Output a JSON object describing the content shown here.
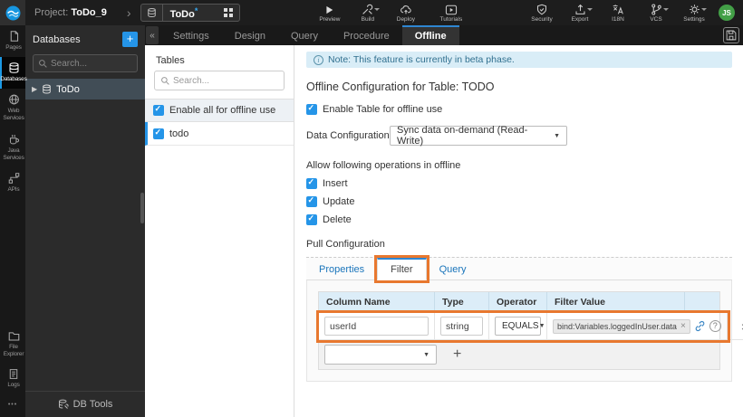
{
  "colors": {
    "accent_blue": "#2595e8",
    "annotation_orange": "#e8782f",
    "avatar_green": "#43a047",
    "note_bg": "#d9edf7"
  },
  "annotations": {
    "highlighted_tab": "Filter",
    "highlighted_row": "userId filter row",
    "color": "#e8782f"
  },
  "topbar": {
    "project_label": "Project:",
    "project_name": "ToDo_9",
    "artifact": {
      "name": "ToDo",
      "modified_mark": "*"
    },
    "actions_left": [
      {
        "label": "Preview"
      },
      {
        "label": "Build"
      },
      {
        "label": "Deploy"
      }
    ],
    "tutorials_label": "Tutorials",
    "actions_right": [
      {
        "label": "Security"
      },
      {
        "label": "Export"
      },
      {
        "label": "I18N"
      },
      {
        "label": "VCS"
      },
      {
        "label": "Settings"
      }
    ],
    "avatar_initials": "JS"
  },
  "sidebar": {
    "items_top": [
      {
        "label": "Pages"
      },
      {
        "label": "Databases"
      },
      {
        "label": "Web Services"
      },
      {
        "label": "Java Services"
      },
      {
        "label": "APIs"
      }
    ],
    "items_bottom": [
      {
        "label": "File Explorer"
      },
      {
        "label": "Logs"
      }
    ],
    "more_label": "•••"
  },
  "db_panel": {
    "title": "Databases",
    "add_button": "+",
    "collapse_icon": "«",
    "search_placeholder": "Search...",
    "tree_items": [
      {
        "label": "ToDo",
        "twisty": "▶"
      }
    ],
    "footer_label": "DB Tools"
  },
  "service_tabs": {
    "items": [
      "Settings",
      "Design",
      "Query",
      "Procedure",
      "Offline"
    ],
    "active": "Offline"
  },
  "tables_panel": {
    "title": "Tables",
    "search_placeholder": "Search...",
    "enable_all_label": "Enable all for offline use",
    "tables": [
      {
        "name": "todo",
        "checked": true
      }
    ]
  },
  "offline_config": {
    "note": "Note: This feature is currently in beta phase.",
    "title": "Offline Configuration for Table: TODO",
    "enable_table_label": "Enable Table for offline use",
    "data_configuration": {
      "label": "Data Configuration",
      "value": "Sync data on-demand (Read-Write)"
    },
    "operations_label": "Allow following operations in offline",
    "operations": [
      {
        "label": "Insert",
        "checked": true
      },
      {
        "label": "Update",
        "checked": true
      },
      {
        "label": "Delete",
        "checked": true
      }
    ],
    "pull_configuration_label": "Pull Configuration",
    "pull_tabs": [
      "Properties",
      "Filter",
      "Query"
    ],
    "pull_active_tab": "Filter",
    "filter_table": {
      "headers": [
        "Column Name",
        "Type",
        "Operator",
        "Filter Value"
      ],
      "rows": [
        {
          "column_name": "userId",
          "type": "string",
          "operator": "EQUALS",
          "filter_value": "bind:Variables.loggedInUser.data"
        }
      ],
      "chip_remove": "×",
      "row_delete": "×",
      "add_button": "+"
    }
  }
}
